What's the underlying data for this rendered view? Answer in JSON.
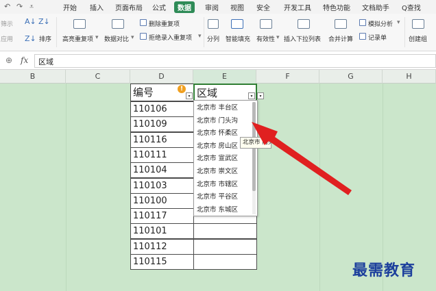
{
  "quick_access": {
    "undo_icon": "↶",
    "redo_icon": "↷",
    "more_icon": "⩡"
  },
  "menu": [
    "开始",
    "插入",
    "页面布局",
    "公式",
    "数据",
    "审阅",
    "视图",
    "安全",
    "开发工具",
    "特色功能",
    "文档助手"
  ],
  "active_menu": "数据",
  "search_label": "Q查找",
  "ribbon": {
    "cut1": "筛示",
    "cut2": "应用",
    "sort": "排序",
    "highlight_dup": "高亮重复项",
    "compare": "数据对比",
    "delete_dup": "删除重复项",
    "reject_dup": "拒绝录入重复项",
    "split": "分列",
    "smart_fill": "智能填充",
    "validity": "有效性",
    "insert_dropdown": "插入下拉列表",
    "consolidate": "合并计算",
    "simulation": "模拟分析",
    "record": "记录单",
    "create_group": "创建组"
  },
  "formula_bar": {
    "fx": "fx",
    "value": "区域"
  },
  "columns": [
    "B",
    "C",
    "D",
    "E",
    "F",
    "G",
    "H"
  ],
  "table": {
    "header_num": "编号",
    "header_area": "区域",
    "warning": "!",
    "ids": [
      "110106",
      "110109",
      "110116",
      "110111",
      "110104",
      "110103",
      "110100",
      "110117",
      "110101",
      "110112",
      "110115"
    ]
  },
  "dropdown_items": [
    "北京市 丰台区",
    "北京市 门头沟",
    "北京市 怀柔区",
    "北京市 房山区",
    "北京市 宣武区",
    "北京市 崇文区",
    "北京市 市辖区",
    "北京市 平谷区",
    "北京市 东城区"
  ],
  "tooltip": "北京市 门头",
  "watermark": "最需教育",
  "colors": {
    "accent": "#2e8b57",
    "grid_bg": "#cbe6cb",
    "arrow": "#e02020",
    "watermark": "#1c3f9c"
  }
}
